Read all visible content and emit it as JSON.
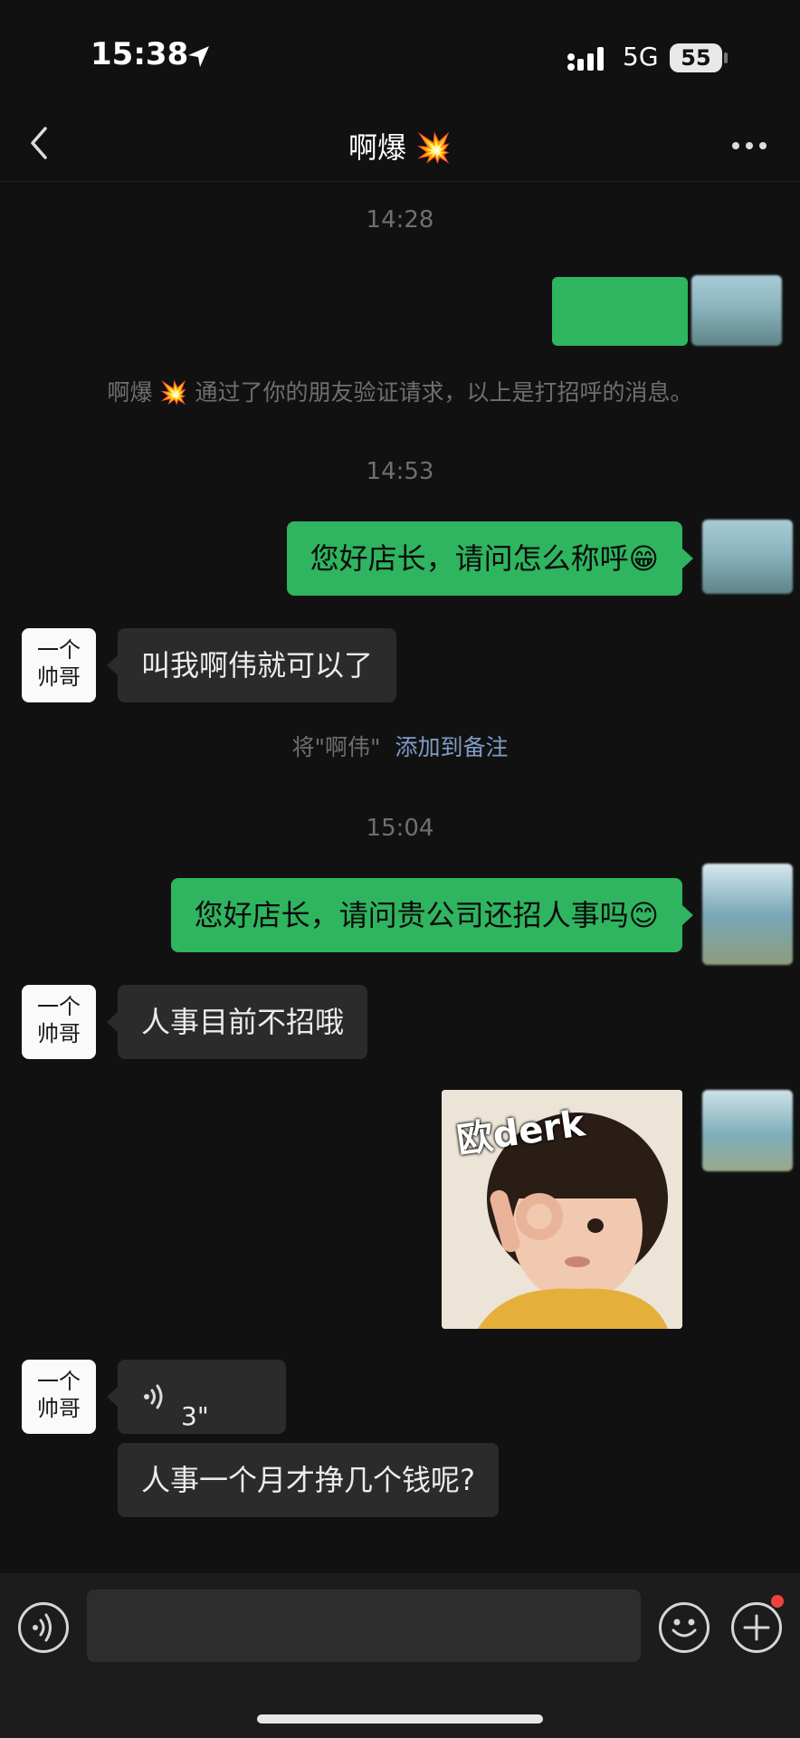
{
  "status_bar": {
    "time": "15:38",
    "network": "5G",
    "battery": "55"
  },
  "nav": {
    "title": "啊爆 💥"
  },
  "chat": {
    "timestamps": [
      "14:28",
      "14:53",
      "15:04"
    ],
    "system_friend": "啊爆 💥 通过了你的朋友验证请求，以上是打招呼的消息。",
    "system_remark_prefix": "将\"啊伟\"",
    "system_remark_link": "添加到备注",
    "messages": [
      {
        "from": "me",
        "text": "您好店长，请问怎么称呼😁"
      },
      {
        "from": "other",
        "text": "叫我啊伟就可以了"
      },
      {
        "from": "me",
        "text": "您好店长，请问贵公司还招人事吗😊"
      },
      {
        "from": "other",
        "text": "人事目前不招哦"
      },
      {
        "from": "other",
        "type": "voice",
        "duration": "3\""
      },
      {
        "from": "other",
        "text": "人事一个月才挣几个钱呢?"
      }
    ],
    "sticker_text": "欧derk",
    "other_avatar_text": [
      "一个",
      "帅哥"
    ]
  },
  "colors": {
    "accent_green": "#2fb45f",
    "background": "#111111",
    "bubble_dark": "#2b2b2b",
    "link": "#7f9cc5"
  },
  "icons": [
    "location-arrow-icon",
    "signal-bars-icon",
    "back-chevron-icon",
    "more-dots-icon",
    "voice-wave-icon",
    "voice-input-icon",
    "emoji-icon",
    "plus-icon"
  ]
}
